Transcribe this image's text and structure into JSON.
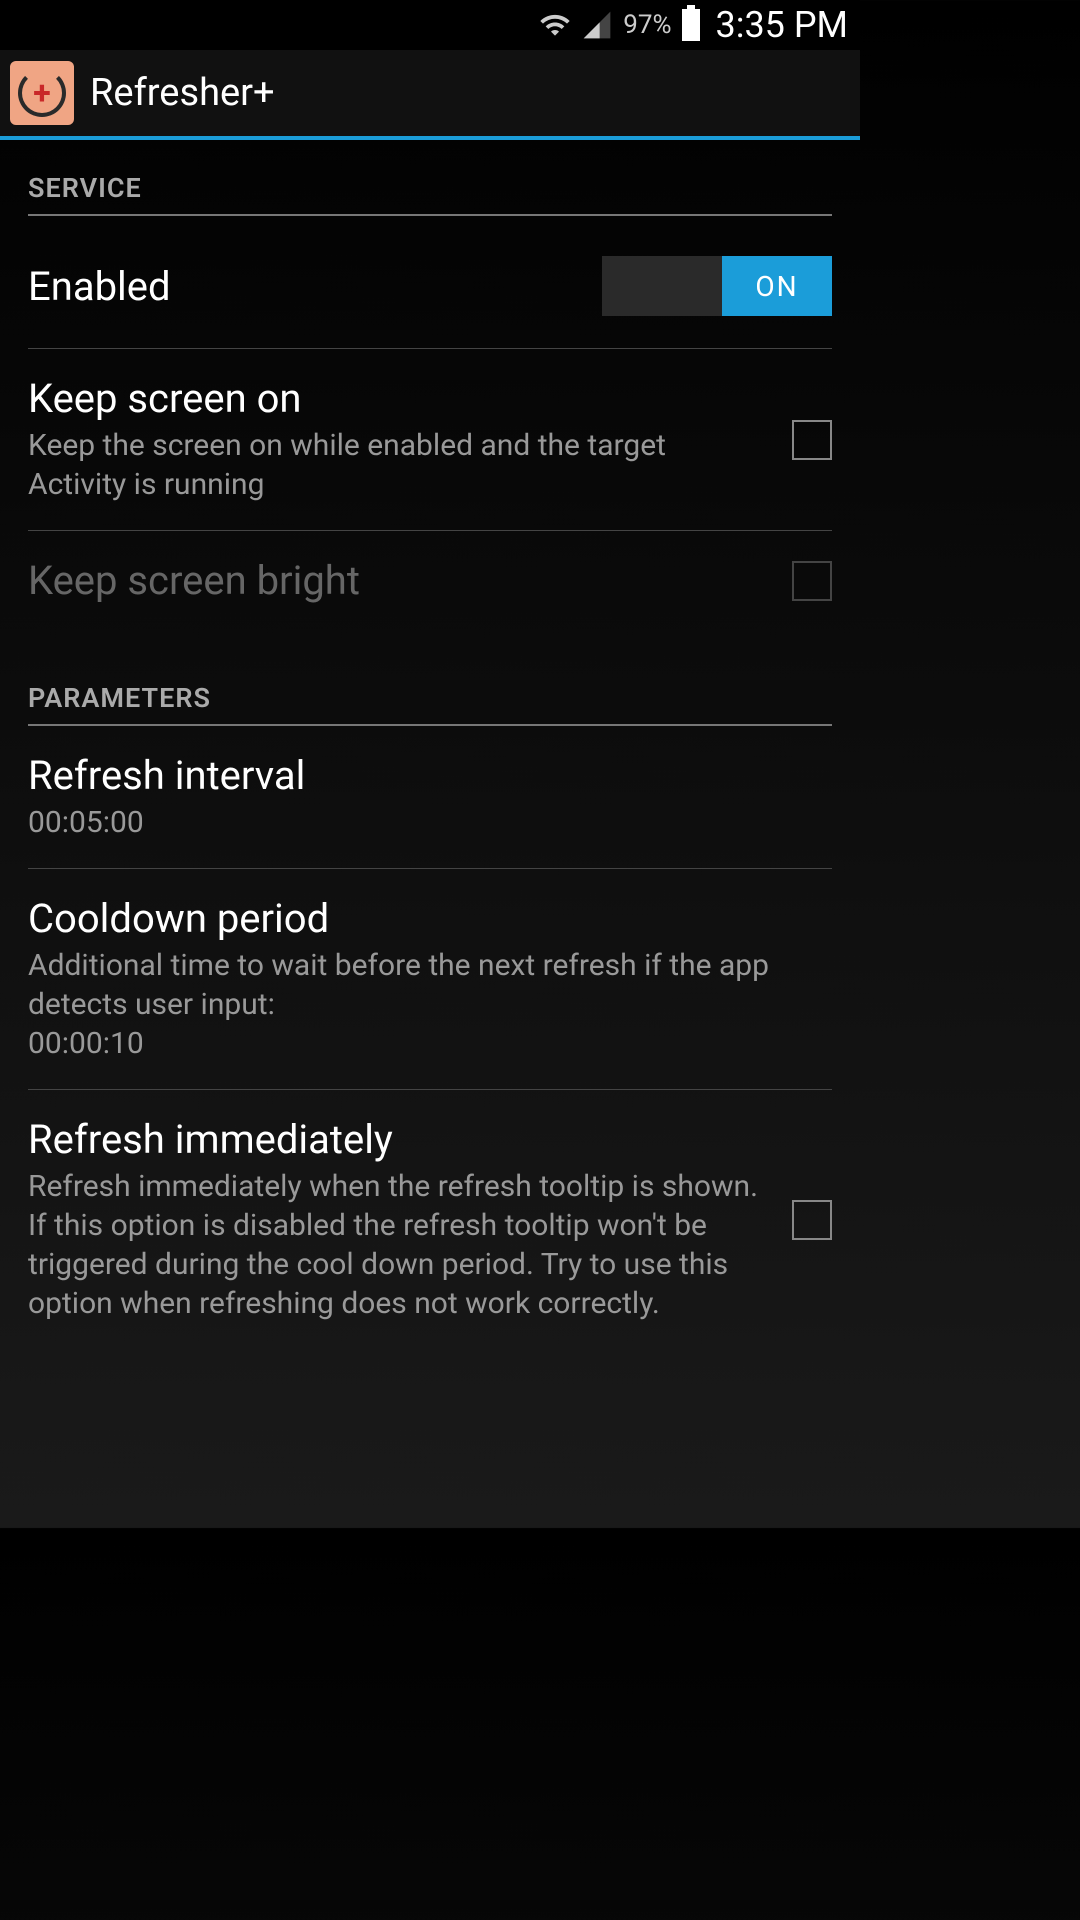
{
  "status_bar": {
    "battery_percent": "97%",
    "time": "3:35 PM"
  },
  "header": {
    "app_title": "Refresher+"
  },
  "sections": {
    "service": {
      "header": "SERVICE",
      "enabled": {
        "title": "Enabled",
        "toggle_state": "ON"
      },
      "keep_screen_on": {
        "title": "Keep screen on",
        "subtitle": "Keep the screen on while enabled and the target Activity is running",
        "checked": false
      },
      "keep_screen_bright": {
        "title": "Keep screen bright",
        "enabled": false,
        "checked": false
      }
    },
    "parameters": {
      "header": "PARAMETERS",
      "refresh_interval": {
        "title": "Refresh interval",
        "value": "00:05:00"
      },
      "cooldown_period": {
        "title": "Cooldown period",
        "subtitle": "Additional time to wait before the next refresh if the app detects user input:",
        "value": "00:00:10"
      },
      "refresh_immediately": {
        "title": "Refresh immediately",
        "subtitle": "Refresh immediately when the refresh tooltip is shown. If this option is disabled the refresh tooltip won't be triggered during the cool down period. Try to use this option when refreshing does not work correctly.",
        "checked": false
      }
    }
  }
}
